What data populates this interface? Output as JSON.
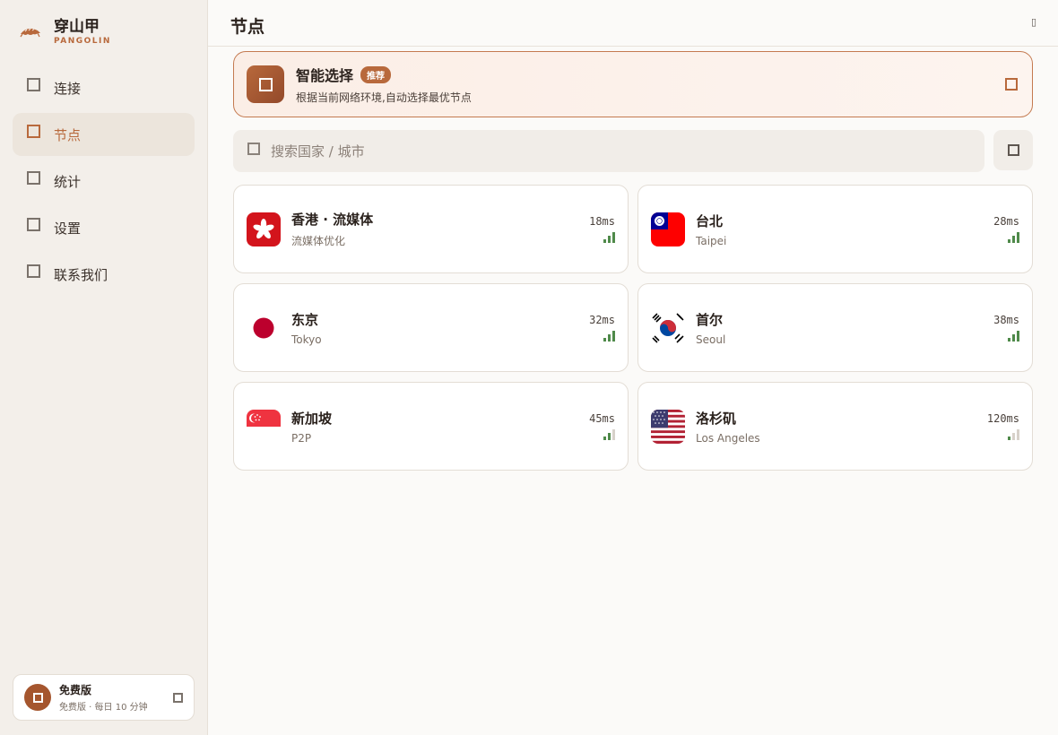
{
  "brand": {
    "name_cn": "穿山甲",
    "name_en": "PANGOLIN"
  },
  "nav": [
    {
      "label": "连接",
      "active": false
    },
    {
      "label": "节点",
      "active": true
    },
    {
      "label": "统计",
      "active": false
    },
    {
      "label": "设置",
      "active": false
    },
    {
      "label": "联系我们",
      "active": false
    }
  ],
  "plan": {
    "title": "免费版",
    "subtitle": "免费版 · 每日 10 分钟"
  },
  "header": {
    "title": "节点",
    "icon_glyph": "▯"
  },
  "smart": {
    "title": "智能选择",
    "badge": "推荐",
    "subtitle": "根据当前网络环境,自动选择最优节点"
  },
  "search": {
    "placeholder": "搜索国家 / 城市",
    "value": ""
  },
  "nodes": [
    {
      "name": "香港 · 流媒体",
      "sub": "流媒体优化",
      "latency": "18ms",
      "signal": 3,
      "flag": "hk-flag"
    },
    {
      "name": "台北",
      "sub": "Taipei",
      "latency": "28ms",
      "signal": 3,
      "flag": "tw-flag"
    },
    {
      "name": "东京",
      "sub": "Tokyo",
      "latency": "32ms",
      "signal": 3,
      "flag": "jp-flag"
    },
    {
      "name": "首尔",
      "sub": "Seoul",
      "latency": "38ms",
      "signal": 3,
      "flag": "kr-flag"
    },
    {
      "name": "新加坡",
      "sub": "P2P",
      "latency": "45ms",
      "signal": 2,
      "flag": "sg-flag"
    },
    {
      "name": "洛杉矶",
      "sub": "Los Angeles",
      "latency": "120ms",
      "signal": 1,
      "flag": "us-flag"
    }
  ],
  "colors": {
    "accent": "#b8693c",
    "signal": "#4f8a4a",
    "signal_dim": "#d7d1ca"
  }
}
